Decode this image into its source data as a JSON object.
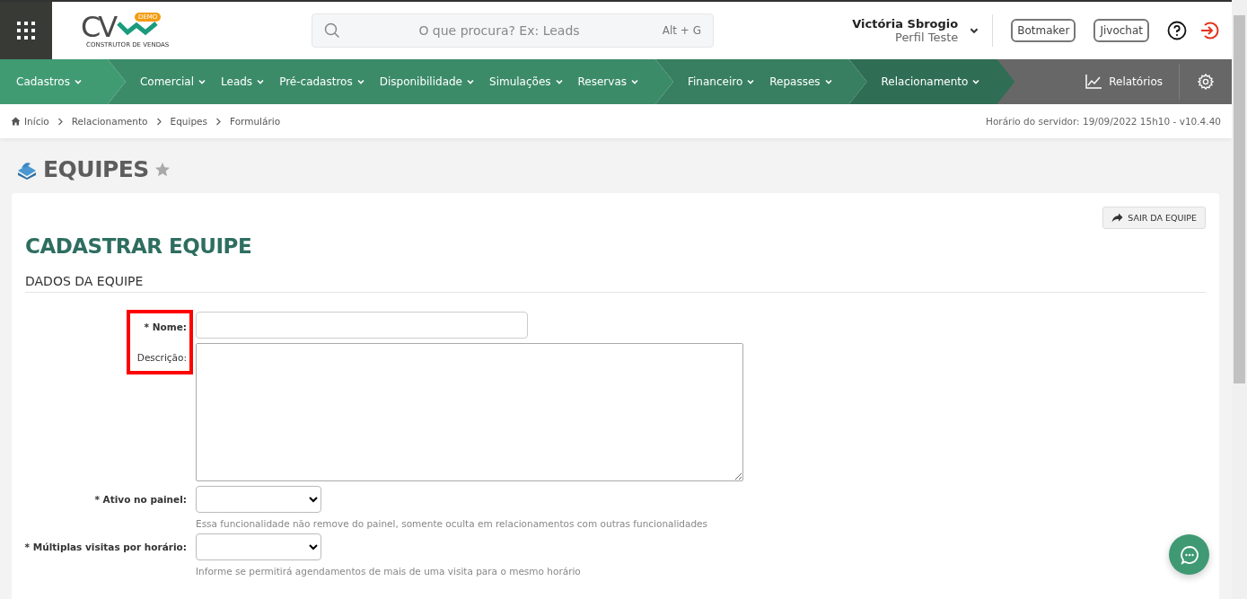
{
  "header": {
    "logo": {
      "letters": "CV",
      "badge": "DEMO",
      "tagline": "CONSTRUTOR DE VENDAS"
    },
    "search": {
      "placeholder": "O que procura? Ex: Leads",
      "shortcut": "Alt + G"
    },
    "user": {
      "name": "Victória Sbrogio",
      "profile": "Perfil Teste"
    },
    "buttons": [
      "Botmaker",
      "Jivochat"
    ]
  },
  "nav": {
    "groups": [
      {
        "color": "#409b73",
        "items": [
          "Cadastros"
        ]
      },
      {
        "color": "#3b8b69",
        "items": [
          "Comercial",
          "Leads",
          "Pré-cadastros",
          "Disponibilidade",
          "Simulações",
          "Reservas"
        ]
      },
      {
        "color": "#377f60",
        "items": [
          "Financeiro",
          "Repasses"
        ]
      },
      {
        "color": "#2f6e55",
        "items": [
          "Relacionamento"
        ]
      }
    ],
    "reports": "Relatórios"
  },
  "breadcrumb": [
    "Início",
    "Relacionamento",
    "Equipes",
    "Formulário"
  ],
  "server_time": "Horário do servidor: 19/09/2022 15h10 - v10.4.40",
  "page": {
    "title": "EQUIPES",
    "favorite": false
  },
  "form": {
    "title": "CADASTRAR EQUIPE",
    "exit_button": "SAIR DA EQUIPE",
    "section": "DADOS DA EQUIPE",
    "fields": [
      {
        "kind": "text",
        "label": "* Nome:",
        "required": true,
        "highlighted": true
      },
      {
        "kind": "textarea",
        "label": "Descrição:",
        "required": false,
        "highlighted": true
      },
      {
        "kind": "select",
        "label": "* Ativo no painel:",
        "required": true,
        "highlighted": false,
        "help": "Essa funcionalidade não remove do painel, somente oculta em relacionamentos com outras funcionalidades"
      },
      {
        "kind": "select",
        "label": "* Múltiplas visitas por horário:",
        "required": true,
        "highlighted": false,
        "help": "Informe se permitirá agendamentos de mais de uma visita para o mesmo horário"
      }
    ]
  }
}
